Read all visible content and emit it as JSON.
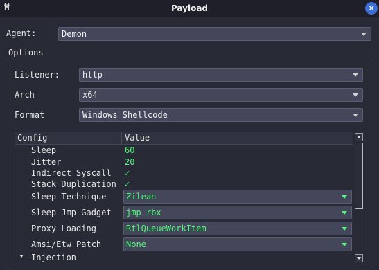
{
  "window": {
    "title": "Payload",
    "icon": "havoc-logo-icon",
    "close_icon": "close-icon"
  },
  "agent": {
    "label": "Agent:",
    "value": "Demon"
  },
  "options": {
    "title": "Options",
    "listener": {
      "label": "Listener:",
      "value": "http"
    },
    "arch": {
      "label": "Arch",
      "value": "x64"
    },
    "format": {
      "label": "Format",
      "value": "Windows Shellcode"
    }
  },
  "config": {
    "columns": [
      "Config",
      "Value"
    ],
    "rows": {
      "sleep": {
        "label": "Sleep",
        "value": "60"
      },
      "jitter": {
        "label": "Jitter",
        "value": "20"
      },
      "indirect_syscall": {
        "label": "Indirect Syscall",
        "value": "✓"
      },
      "stack_duplication": {
        "label": "Stack Duplication",
        "value": "✓"
      },
      "sleep_technique": {
        "label": "Sleep Technique",
        "value": "Zilean"
      },
      "sleep_jmp_gadget": {
        "label": "Sleep Jmp Gadget",
        "value": "jmp rbx"
      },
      "proxy_loading": {
        "label": "Proxy Loading",
        "value": "RtlQueueWorkItem"
      },
      "amsi_etw_patch": {
        "label": "Amsi/Etw Patch",
        "value": "None"
      },
      "injection": {
        "label": "Injection"
      }
    }
  },
  "colors": {
    "background": "#282a36",
    "value_green": "#50fa7b",
    "close_blue": "#3b6fd6"
  }
}
